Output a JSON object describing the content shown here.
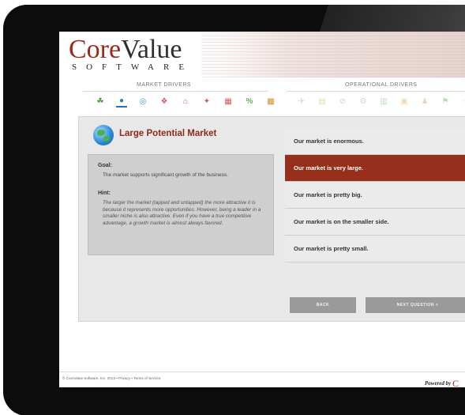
{
  "logo": {
    "core": "Core",
    "value": "Value",
    "software": "SOFTWARE"
  },
  "drivers": {
    "market_label": "MARKET DRIVERS",
    "operational_label": "OPERATIONAL DRIVERS"
  },
  "market_icons": [
    {
      "name": "seedling-icon",
      "glyph": "☘",
      "color": "#3a9a2a",
      "active": false
    },
    {
      "name": "globe-icon",
      "glyph": "●",
      "color": "#1f7fc4",
      "active": true
    },
    {
      "name": "target-icon",
      "glyph": "◎",
      "color": "#4a9ad0",
      "active": false
    },
    {
      "name": "puzzle-icon",
      "glyph": "❖",
      "color": "#d9534f",
      "active": false
    },
    {
      "name": "house-icon",
      "glyph": "⌂",
      "color": "#d9534f",
      "active": false
    },
    {
      "name": "shield-icon",
      "glyph": "✦",
      "color": "#d9534f",
      "active": false
    },
    {
      "name": "calendar-icon",
      "glyph": "▦",
      "color": "#d9534f",
      "active": false
    },
    {
      "name": "percent-icon",
      "glyph": "%",
      "color": "#3a9a2a",
      "active": false
    },
    {
      "name": "grid-icon",
      "glyph": "▩",
      "color": "#d98a2a",
      "active": false
    }
  ],
  "operational_icons": [
    {
      "name": "plane-icon",
      "glyph": "✈",
      "color": "#888",
      "active": false
    },
    {
      "name": "document-icon",
      "glyph": "▤",
      "color": "#b0a020",
      "active": false
    },
    {
      "name": "no-entry-icon",
      "glyph": "⊘",
      "color": "#d9534f",
      "active": false
    },
    {
      "name": "gear-icon",
      "glyph": "⚙",
      "color": "#888",
      "active": false
    },
    {
      "name": "clipboard-icon",
      "glyph": "▥",
      "color": "#3a9a2a",
      "active": false
    },
    {
      "name": "briefcase-icon",
      "glyph": "▣",
      "color": "#d98a2a",
      "active": false
    },
    {
      "name": "people-icon",
      "glyph": "♟",
      "color": "#d98a2a",
      "active": false
    },
    {
      "name": "signpost-icon",
      "glyph": "⚑",
      "color": "#3a9a2a",
      "active": false
    },
    {
      "name": "lightbulb-icon",
      "glyph": "☀",
      "color": "#d9c020",
      "active": false
    }
  ],
  "question": {
    "title": "Large Potential Market",
    "goal_heading": "Goal:",
    "goal": "The market supports significant growth of the business.",
    "hint_heading": "Hint:",
    "hint": "The larger the market (tapped and untapped) the more attractive it is because it represents more opportunities. However, being a leader in a smaller niche is also attractive. Even if you have a true competitive advantage, a growth market is almost always favored."
  },
  "answers": [
    {
      "label": "Our market is enormous.",
      "selected": false
    },
    {
      "label": "Our market is very large.",
      "selected": true
    },
    {
      "label": "Our market is pretty big.",
      "selected": false
    },
    {
      "label": "Our market is on the smaller side.",
      "selected": false
    },
    {
      "label": "Our market is pretty small.",
      "selected": false
    }
  ],
  "buttons": {
    "back": "BACK",
    "next": "NEXT QUESTION  >"
  },
  "footer": {
    "copyright": "© CoreValue Software, Inc. 2013 • ",
    "privacy": "Privacy",
    "sep": " • ",
    "terms": "Terms of Service",
    "powered": "Powered by ",
    "powered_mark": "C"
  },
  "colors": {
    "brand_red": "#962f1b",
    "button_grey": "#9a9a9a",
    "panel_grey": "#e8e8e8"
  }
}
